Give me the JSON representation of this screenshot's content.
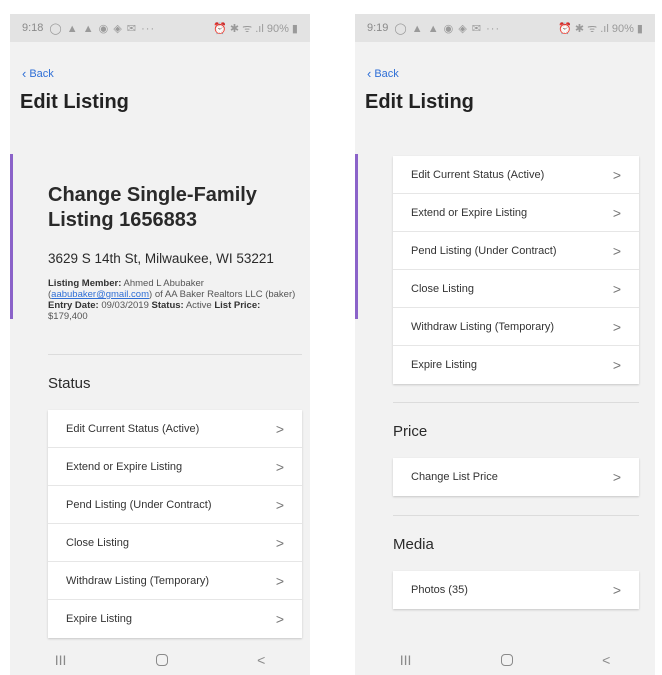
{
  "left": {
    "status_bar": {
      "time": "9:18",
      "icons": "◯ ▲ ▲ ◉ ◈ ✉ ···",
      "right": "⏰ ✱ ᯤ .ıl 90% ▮"
    },
    "back_label": "Back",
    "page_title": "Edit Listing",
    "listing_title": "Change Single-Family Listing 1656883",
    "address": "3629 S 14th St, Milwaukee, WI 53221",
    "meta": {
      "member_label": "Listing Member:",
      "member_name": "Ahmed L Abubaker",
      "email": "aabubaker@gmail.com",
      "company": "of AA Baker Realtors LLC (baker)",
      "entry_label": "Entry Date:",
      "entry_date": "09/03/2019",
      "status_label": "Status:",
      "status_value": "Active",
      "price_label": "List Price:",
      "price_value": "$179,400"
    },
    "status_section": "Status",
    "status_items": [
      "Edit Current Status (Active)",
      "Extend or Expire Listing",
      "Pend Listing (Under Contract)",
      "Close Listing",
      "Withdraw Listing (Temporary)",
      "Expire Listing"
    ]
  },
  "right": {
    "status_bar": {
      "time": "9:19",
      "icons": "◯ ▲ ▲ ◉ ◈ ✉ ···",
      "right": "⏰ ✱ ᯤ .ıl 90% ▮"
    },
    "back_label": "Back",
    "page_title": "Edit Listing",
    "status_items": [
      "Edit Current Status (Active)",
      "Extend or Expire Listing",
      "Pend Listing (Under Contract)",
      "Close Listing",
      "Withdraw Listing (Temporary)",
      "Expire Listing"
    ],
    "price_section": "Price",
    "price_items": [
      "Change List Price"
    ],
    "media_section": "Media",
    "media_items": [
      "Photos (35)"
    ]
  },
  "nav": {
    "recents": "III",
    "back": "<"
  },
  "chevron": ">",
  "accent_color": "#8b63c9",
  "link_color": "#2f6fd6"
}
